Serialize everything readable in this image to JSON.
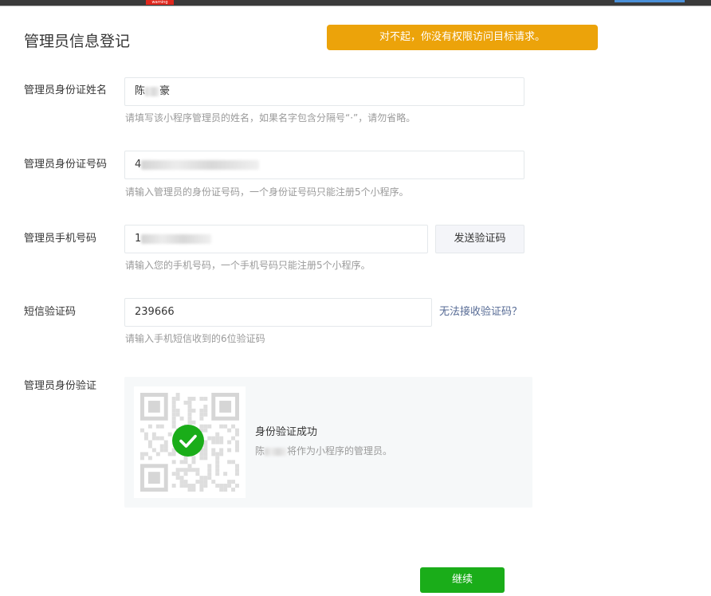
{
  "topbar": {
    "warning_tag": "warning"
  },
  "page": {
    "title": "管理员信息登记"
  },
  "alert": {
    "text": "对不起，你没有权限访问目标请求。"
  },
  "form": {
    "name": {
      "label": "管理员身份证姓名",
      "value_visible_start": "陈",
      "value_visible_end": "豪",
      "hint": "请填写该小程序管理员的姓名，如果名字包含分隔号“·”，请勿省略。"
    },
    "id_number": {
      "label": "管理员身份证号码",
      "value_visible": "4",
      "hint": "请输入管理员的身份证号码，一个身份证号码只能注册5个小程序。"
    },
    "phone": {
      "label": "管理员手机号码",
      "value_visible": "1",
      "send_code_button": "发送验证码",
      "hint": "请输入您的手机号码，一个手机号码只能注册5个小程序。"
    },
    "sms_code": {
      "label": "短信验证码",
      "value": "239666",
      "cannot_receive_link": "无法接收验证码？",
      "hint": "请输入手机短信收到的6位验证码"
    },
    "identity_verify": {
      "label": "管理员身份验证",
      "status_title": "身份验证成功",
      "status_desc_visible_start": "陈",
      "status_desc": "将作为小程序的管理员。",
      "icons": [
        "qr-code-icon",
        "check-icon"
      ]
    }
  },
  "actions": {
    "continue_label": "继续"
  },
  "colors": {
    "primary_green": "#1aad19",
    "alert_orange": "#eca30a",
    "link_blue": "#576b95",
    "hint_gray": "#9a9a9a"
  }
}
